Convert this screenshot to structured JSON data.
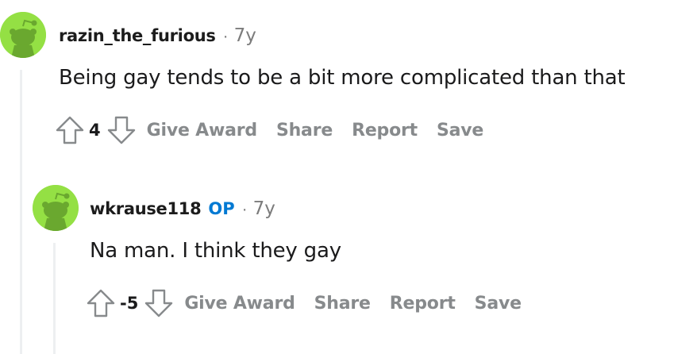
{
  "comments": [
    {
      "username": "razin_the_furious",
      "op_badge": "",
      "separator": "·",
      "age": "7y",
      "body": "Being gay tends to be a bit more complicated than that",
      "score": "4",
      "avatar_icon": "snoo-avatar-icon",
      "actions": [
        "Give Award",
        "Share",
        "Report",
        "Save"
      ]
    },
    {
      "username": "wkrause118",
      "op_badge": "OP",
      "separator": "·",
      "age": "7y",
      "body": "Na man. I think they gay",
      "score": "-5",
      "avatar_icon": "snoo-avatar-icon",
      "actions": [
        "Give Award",
        "Share",
        "Report",
        "Save"
      ]
    }
  ],
  "colors": {
    "avatar_bg": "#94e044",
    "op_badge": "#0079d3",
    "muted": "#878a8c",
    "thread_line": "#edeff1"
  }
}
